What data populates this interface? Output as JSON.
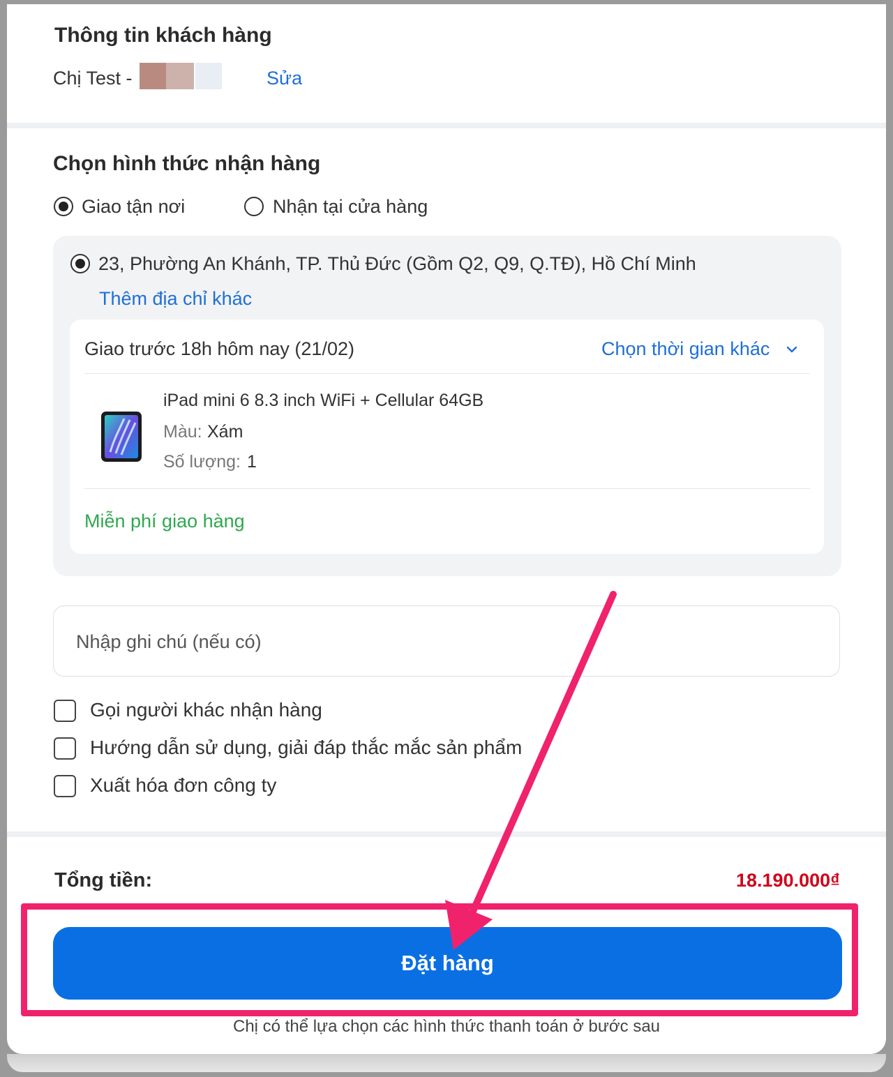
{
  "customer": {
    "section_title": "Thông tin khách hàng",
    "name_prefix": "Chị Test -",
    "edit_link": "Sửa"
  },
  "delivery": {
    "section_title": "Chọn hình thức nhận hàng",
    "options": [
      {
        "label": "Giao tận nơi",
        "selected": true
      },
      {
        "label": "Nhận tại cửa hàng",
        "selected": false
      }
    ],
    "address": "23, Phường An Khánh, TP. Thủ Đức (Gồm Q2, Q9, Q.TĐ), Hồ Chí Minh",
    "add_address_link": "Thêm địa chỉ khác",
    "schedule": {
      "label": "Giao trước 18h hôm nay (21/02)",
      "change_link": "Chọn thời gian khác"
    },
    "product": {
      "name": "iPad mini 6 8.3 inch WiFi + Cellular 64GB",
      "color_label": "Màu:",
      "color_value": "Xám",
      "qty_label": "Số lượng:",
      "qty_value": "1"
    },
    "shipping_note": "Miễn phí giao hàng"
  },
  "note": {
    "placeholder": "Nhập ghi chú (nếu có)"
  },
  "options": [
    {
      "label": "Gọi người khác nhận hàng",
      "checked": false
    },
    {
      "label": "Hướng dẫn sử dụng, giải đáp thắc mắc sản phẩm",
      "checked": false
    },
    {
      "label": "Xuất hóa đơn công ty",
      "checked": false
    }
  ],
  "summary": {
    "total_label": "Tổng tiền:",
    "total_value": "18.190.000₫"
  },
  "order_button": "Đặt hàng",
  "payment_hint": "Chị có thể lựa chọn các hình thức thanh toán ở bước sau",
  "colors": {
    "primary": "#0a6fe3",
    "link": "#1f6fd6",
    "price": "#d0021b",
    "free_shipping": "#2fa84f",
    "annotation": "#f0226c"
  }
}
